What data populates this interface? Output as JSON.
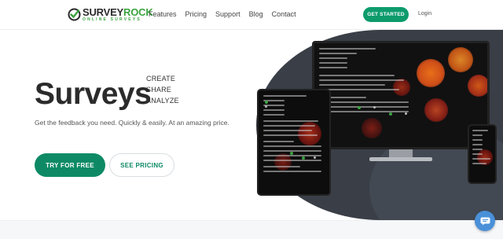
{
  "brand": {
    "name_dark": "SURVEY",
    "name_green": "ROCK",
    "tagline": "ONLINE SURVEYS",
    "color_green": "#3aa33f"
  },
  "nav": {
    "items": [
      "Features",
      "Pricing",
      "Support",
      "Blog",
      "Contact"
    ],
    "cta": "GET STARTED",
    "login": "Login"
  },
  "hero": {
    "title": "Surveys",
    "keywords": [
      "CREATE",
      "SHARE",
      "ANALYZE"
    ],
    "lead": "Get the feedback you need. Quickly & easily. At an amazing price.",
    "primary_button": "TRY FOR FREE",
    "secondary_button": "SEE PRICING"
  },
  "colors": {
    "accent": "#0d8a65",
    "dark_panel": "#3a3f47",
    "chat": "#4a90d9"
  },
  "icons": {
    "logo": "check-circle-icon",
    "chat": "chat-bubble-icon"
  }
}
